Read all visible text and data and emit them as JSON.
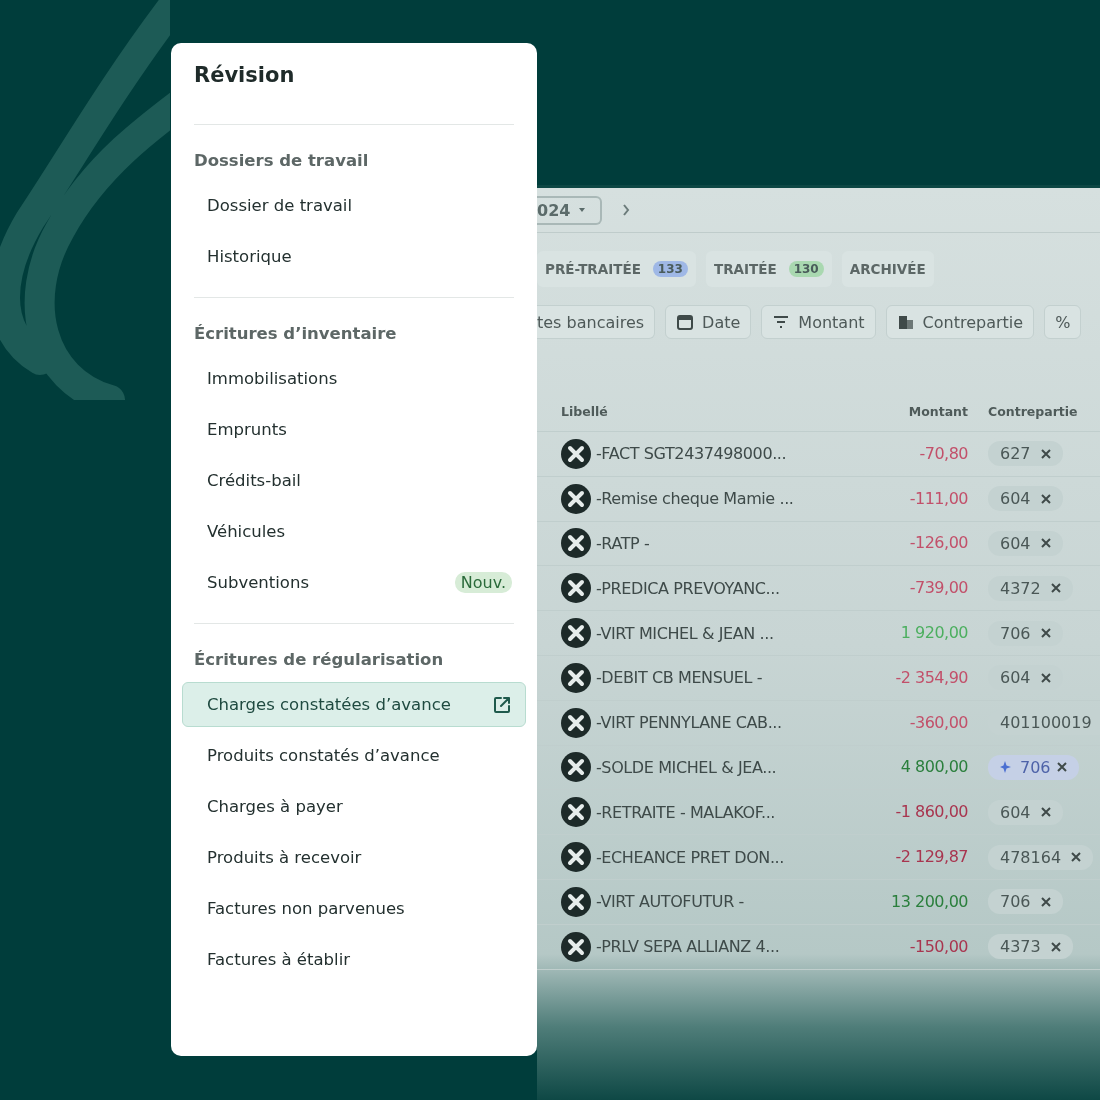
{
  "menu": {
    "title": "Révision",
    "sections": [
      {
        "heading": "Dossiers de travail",
        "items": [
          {
            "label": "Dossier de travail",
            "selected": false
          },
          {
            "label": "Historique",
            "selected": false
          }
        ]
      },
      {
        "heading": "Écritures d’inventaire",
        "items": [
          {
            "label": "Immobilisations",
            "selected": false
          },
          {
            "label": "Emprunts",
            "selected": false
          },
          {
            "label": "Crédits-bail",
            "selected": false
          },
          {
            "label": "Véhicules",
            "selected": false
          },
          {
            "label": "Subventions",
            "selected": false,
            "badge": "Nouv."
          }
        ]
      },
      {
        "heading": "Écritures de régularisation",
        "items": [
          {
            "label": "Charges constatées d’avance",
            "selected": true
          },
          {
            "label": "Produits constatés d’avance",
            "selected": false
          },
          {
            "label": "Charges à payer",
            "selected": false
          },
          {
            "label": "Produits à recevoir",
            "selected": false
          },
          {
            "label": "Factures non parvenues",
            "selected": false
          },
          {
            "label": "Factures à établir",
            "selected": false
          }
        ]
      }
    ]
  },
  "app": {
    "period": "024",
    "tabs": [
      {
        "label": "PRÉ-TRAITÉE",
        "count": "133",
        "color": "#9fb8e6"
      },
      {
        "label": "TRAITÉE",
        "count": "130",
        "color": "#a9d8b0"
      },
      {
        "label": "ARCHIVÉE"
      }
    ],
    "filters": [
      {
        "label": "tes bancaires",
        "kind": "plain"
      },
      {
        "label": "Date",
        "kind": "calendar"
      },
      {
        "label": "Montant",
        "kind": "filter"
      },
      {
        "label": "Contrepartie",
        "kind": "building"
      },
      {
        "label": "%",
        "kind": "plain"
      }
    ],
    "table": {
      "columns": [
        "Libellé",
        "Montant",
        "Contrepartie"
      ],
      "rows": [
        {
          "label": "-FACT SGT2437498000...",
          "amount": "-70,80",
          "color": "#c2506a",
          "account": "627",
          "suggested": false
        },
        {
          "label": "-Remise cheque Mamie ...",
          "amount": "-111,00",
          "color": "#c2506a",
          "account": "604",
          "suggested": false
        },
        {
          "label": "-RATP -",
          "amount": "-126,00",
          "color": "#c2506a",
          "account": "604",
          "suggested": false
        },
        {
          "label": "-PREDICA PREVOYANC...",
          "amount": "-739,00",
          "color": "#c2506a",
          "account": "4372",
          "suggested": false
        },
        {
          "label": "-VIRT MICHEL & JEAN ...",
          "amount": "1 920,00",
          "color": "#4caf5f",
          "account": "706",
          "suggested": false
        },
        {
          "label": "-DEBIT CB MENSUEL -",
          "amount": "-2 354,90",
          "color": "#c2506a",
          "account": "604",
          "suggested": false
        },
        {
          "label": "-VIRT PENNYLANE CAB...",
          "amount": "-360,00",
          "color": "#c2506a",
          "account": "401100019",
          "suggested": false
        },
        {
          "label": "-SOLDE MICHEL & JEA...",
          "amount": "4 800,00",
          "color": "#2a7f3c",
          "account": "706",
          "suggested": true
        },
        {
          "label": "-RETRAITE - MALAKOF...",
          "amount": "-1 860,00",
          "color": "#a8354f",
          "account": "604",
          "suggested": false
        },
        {
          "label": "-ECHEANCE PRET DON...",
          "amount": "-2 129,87",
          "color": "#a8354f",
          "account": "478164",
          "suggested": false
        },
        {
          "label": "-VIRT AUTOFUTUR -",
          "amount": "13 200,00",
          "color": "#2a7f3c",
          "account": "706",
          "suggested": false
        },
        {
          "label": "-PRLV SEPA ALLIANZ 4...",
          "amount": "-150,00",
          "color": "#a8354f",
          "account": "4373",
          "suggested": false
        }
      ]
    }
  }
}
